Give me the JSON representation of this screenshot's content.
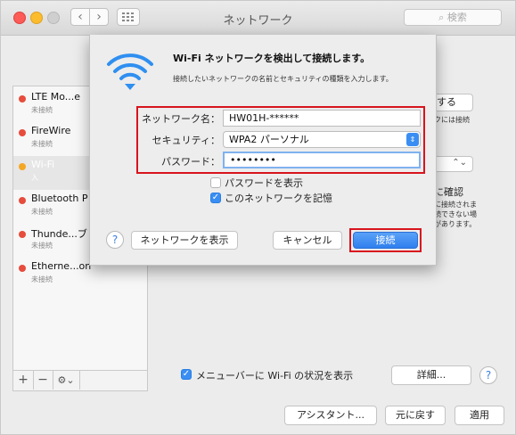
{
  "window": {
    "title": "ネットワーク",
    "search_placeholder": "検索",
    "nav_back": "‹",
    "nav_forward": "›",
    "grid_icon": "grid-icon"
  },
  "sidebar": {
    "services": [
      {
        "name": "LTE Mo...e",
        "status": "未接続",
        "color": "#e74c3c"
      },
      {
        "name": "FireWire",
        "status": "未接続",
        "color": "#e74c3c"
      },
      {
        "name": "Wi-Fi",
        "status": "入",
        "color": "#f5a623"
      },
      {
        "name": "Bluetooth P",
        "status": "未接続",
        "color": "#e74c3c"
      },
      {
        "name": "Thunde...ブ",
        "status": "未接続",
        "color": "#e74c3c"
      },
      {
        "name": "Etherne...on",
        "status": "未接続",
        "color": "#e74c3c"
      }
    ],
    "add": "+",
    "remove": "−",
    "gear": "⚙︎⌄"
  },
  "detail": {
    "connect_partial": "する",
    "network_note_partial": "クには接続",
    "ask_partial": "に確認",
    "ask_desc_partial": [
      "に接続されま",
      "続できない場",
      "があります。"
    ],
    "menubar_label": "メニューバーに Wi-Fi の状況を表示",
    "menubar_checked": true,
    "advanced_button": "詳細...",
    "help": "?",
    "assistant_button": "アシスタント...",
    "revert_button": "元に戻す",
    "apply_button": "適用"
  },
  "sheet": {
    "title": "Wi-Fi ネットワークを検出して接続します。",
    "subtitle": "接続したいネットワークの名前とセキュリティの種類を入力します。",
    "network_name_label": "ネットワーク名：",
    "network_name_value": "HW01H-******",
    "security_label": "セキュリティ：",
    "security_value": "WPA2 パーソナル",
    "password_label": "パスワード：",
    "password_value": "••••••••",
    "show_password_label": "パスワードを表示",
    "show_password_checked": false,
    "remember_label": "このネットワークを記憶",
    "remember_checked": true,
    "help": "?",
    "show_networks_button": "ネットワークを表示",
    "cancel_button": "キャンセル",
    "connect_button": "接続"
  },
  "colors": {
    "highlight": "#d8141d",
    "accent": "#3a8ef3",
    "wifi_icon": "#2f8ff0"
  }
}
